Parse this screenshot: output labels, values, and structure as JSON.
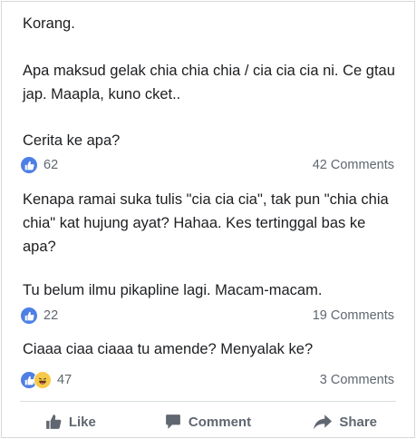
{
  "comments": [
    {
      "text": "Korang."
    },
    {
      "text": "Apa maksud gelak chia chia chia / cia cia cia ni. Ce gtau jap. Maapla, kuno cket.."
    },
    {
      "text": "Cerita ke apa?",
      "reaction_count": "62",
      "comment_count": "42 Comments"
    },
    {
      "text": "Kenapa ramai suka tulis \"cia cia cia\", tak pun \"chia chia chia\" kat hujung ayat? Hahaa. Kes tertinggal bas ke apa?"
    },
    {
      "text": "Tu belum ilmu pikapline lagi. Macam-macam.",
      "reaction_count": "22",
      "comment_count": "19 Comments"
    },
    {
      "text": "Ciaaa ciaa ciaaa tu amende? Menyalak ke?",
      "reaction_count": "47",
      "comment_count": "3 Comments"
    }
  ],
  "reactions": {
    "like_icon": "thumbs-up-icon",
    "haha_icon": "laughing-face-icon",
    "like_color": "#4e7fe5",
    "haha_color": "#f7c94a"
  },
  "actions": {
    "like_label": "Like",
    "comment_label": "Comment",
    "share_label": "Share"
  }
}
